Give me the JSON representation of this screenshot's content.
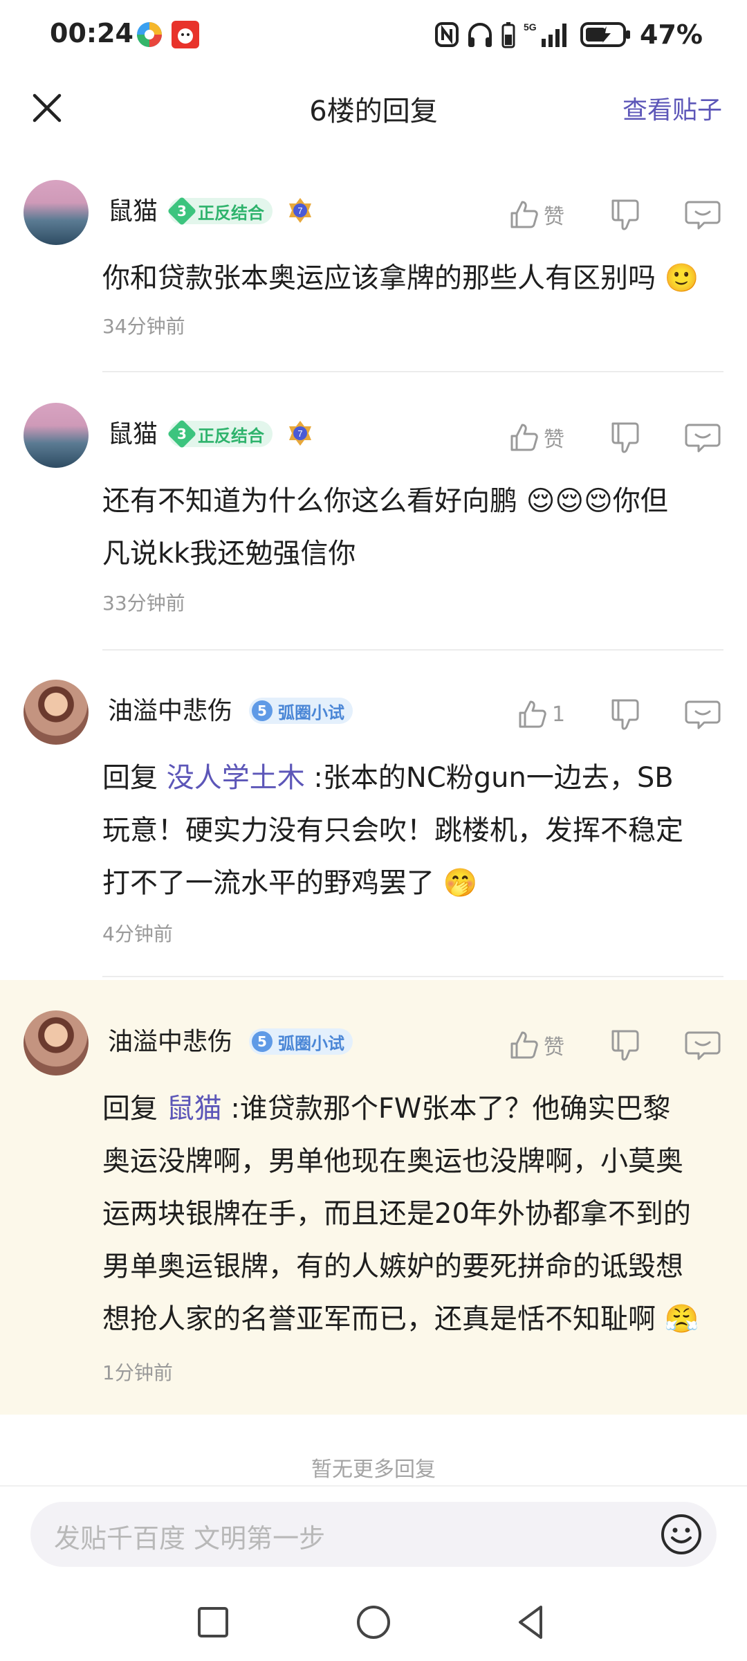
{
  "status_bar": {
    "time": "00:24",
    "network": "5G",
    "battery": "47%"
  },
  "header": {
    "title": "6楼的回复",
    "view_post": "查看贴子"
  },
  "posts": [
    {
      "username": "鼠猫",
      "badge_level": "3",
      "badge_text": "正反结合",
      "medal_level": "7",
      "like_label": "赞",
      "content": "你和贷款张本奥运应该拿牌的那些人有区别吗 🙂",
      "time": "34分钟前"
    },
    {
      "username": "鼠猫",
      "badge_level": "3",
      "badge_text": "正反结合",
      "medal_level": "7",
      "like_label": "赞",
      "content_line1": "还有不知道为什么你这么看好向鹏 😌😌😌你但",
      "content_line2": "凡说kk我还勉强信你",
      "time": "33分钟前"
    },
    {
      "username": "油溢中悲伤",
      "badge_level": "5",
      "badge_text": "弧圈小试",
      "like_label": "1",
      "reply_prefix": "回复 ",
      "mention": "没人学土木",
      "content_line1_rest": " :张本的NC粉gun一边去，SB",
      "content_line2": "玩意！硬实力没有只会吹！跳楼机，发挥不稳定",
      "content_line3": "打不了一流水平的野鸡罢了 🤭",
      "time": "4分钟前"
    },
    {
      "username": "油溢中悲伤",
      "badge_level": "5",
      "badge_text": "弧圈小试",
      "like_label": "赞",
      "reply_prefix": "回复 ",
      "mention": "鼠猫",
      "content_line1_rest": " :谁贷款那个FW张本了？他确实巴黎",
      "content_line2": "奥运没牌啊，男单他现在奥运也没牌啊，小莫奥",
      "content_line3": "运两块银牌在手，而且还是20年外协都拿不到的",
      "content_line4": "男单奥运银牌，有的人嫉妒的要死拼命的诋毁想",
      "content_line5": "想抢人家的名誉亚军而已，还真是恬不知耻啊 😤",
      "time": "1分钟前"
    }
  ],
  "footer": {
    "no_more": "暂无更多回复",
    "comment_placeholder": "发贴千百度 文明第一步"
  },
  "icons": {
    "accent": "#5c56b8",
    "badge_green": "#3cc47e",
    "badge_blue": "#5f9ae6",
    "highlight_bg": "#fcf8ea"
  }
}
